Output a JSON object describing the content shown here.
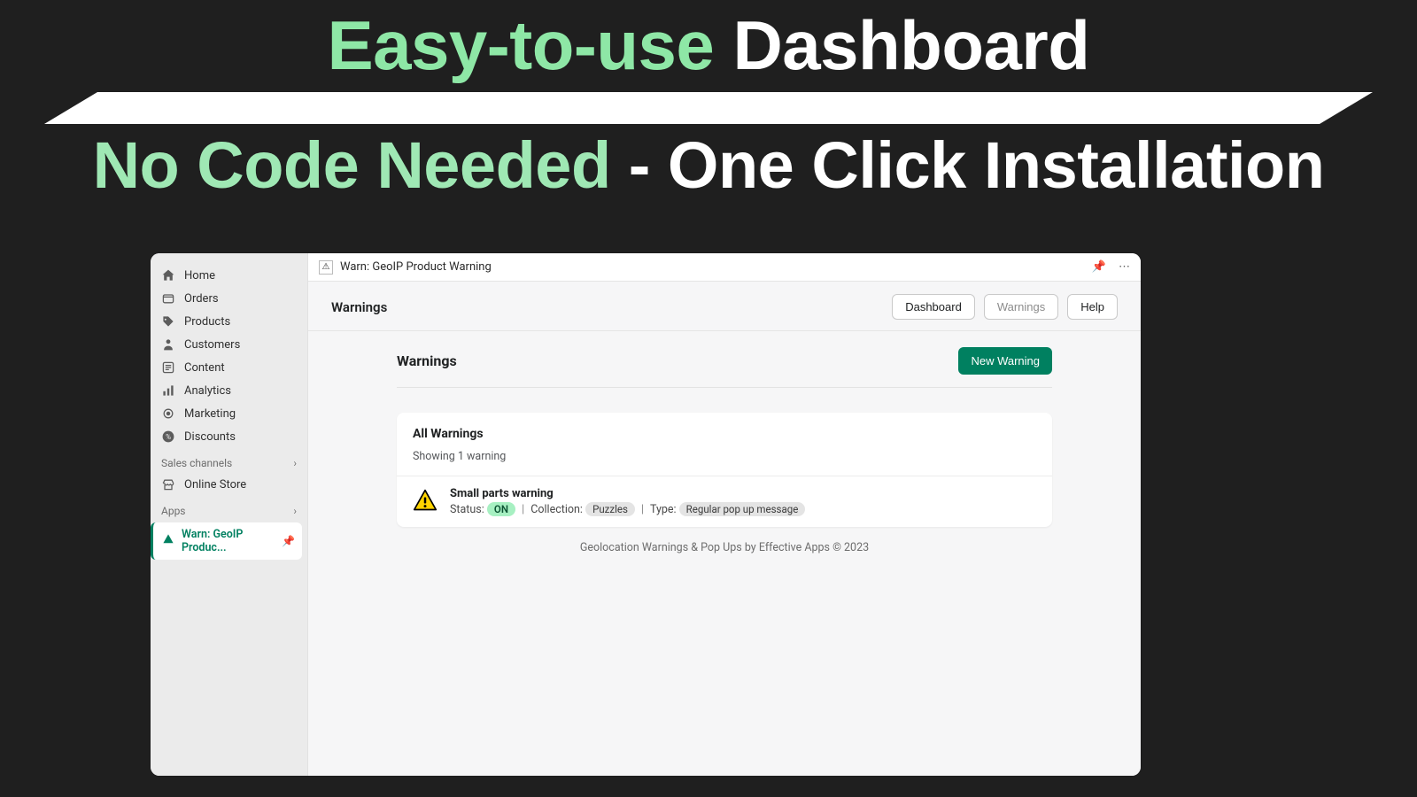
{
  "hero": {
    "line1_accent": "Easy-to-use",
    "line1_rest": " Dashboard",
    "line2_accent": "No Code Needed",
    "line2_rest": " - One Click Installation"
  },
  "sidebar": {
    "items": [
      {
        "label": "Home"
      },
      {
        "label": "Orders"
      },
      {
        "label": "Products"
      },
      {
        "label": "Customers"
      },
      {
        "label": "Content"
      },
      {
        "label": "Analytics"
      },
      {
        "label": "Marketing"
      },
      {
        "label": "Discounts"
      }
    ],
    "section_sales": "Sales channels",
    "online_store": "Online Store",
    "section_apps": "Apps",
    "active_app": "Warn: GeoIP Produc..."
  },
  "topbar": {
    "app_name": "Warn: GeoIP Product Warning"
  },
  "subhead": {
    "title": "Warnings",
    "tab_dashboard": "Dashboard",
    "tab_warnings": "Warnings",
    "tab_help": "Help"
  },
  "page": {
    "title": "Warnings",
    "new_button": "New Warning",
    "card_title": "All Warnings",
    "card_sub": "Showing 1 warning",
    "row": {
      "title": "Small parts warning",
      "status_label": "Status:",
      "status_value": "ON",
      "collection_label": "Collection:",
      "collection_value": "Puzzles",
      "type_label": "Type:",
      "type_value": "Regular pop up message"
    },
    "footer": "Geolocation Warnings & Pop Ups by Effective Apps © 2023"
  }
}
